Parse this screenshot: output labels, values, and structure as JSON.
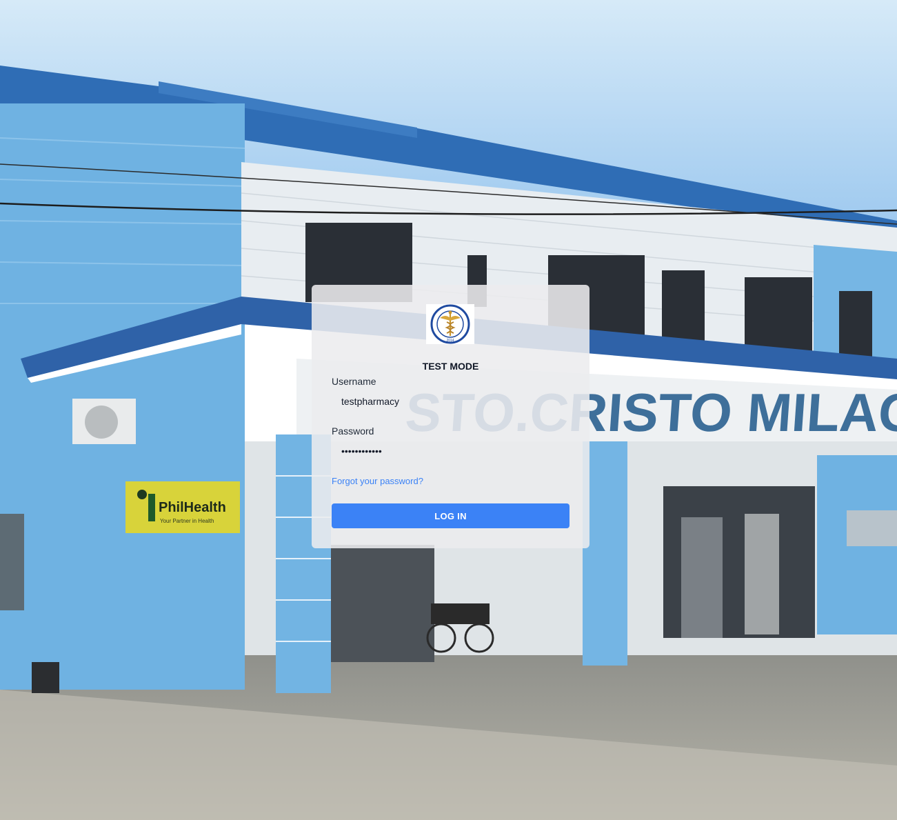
{
  "background": {
    "description_icon": "hospital-building-photo-icon",
    "building_sign_text": "STO.CRISTO MILAGROSO",
    "sign_brand_text": "PhilHealth",
    "sign_brand_subtext": "Your Partner in Health"
  },
  "login": {
    "logo_text": "STO. CRISTO MILAGROSO HOSPITAL INC.",
    "logo_year": "2014",
    "mode_label": "TEST MODE",
    "username_label": "Username",
    "username_value": "testpharmacy",
    "password_label": "Password",
    "password_value": "••••••••••••",
    "forgot_link": "Forgot your password?",
    "submit_label": "LOG IN"
  },
  "colors": {
    "accent": "#3b82f6",
    "card_bg": "#ececee",
    "sky_top": "#bcdcf7",
    "wall_blue": "#6db3e4"
  }
}
